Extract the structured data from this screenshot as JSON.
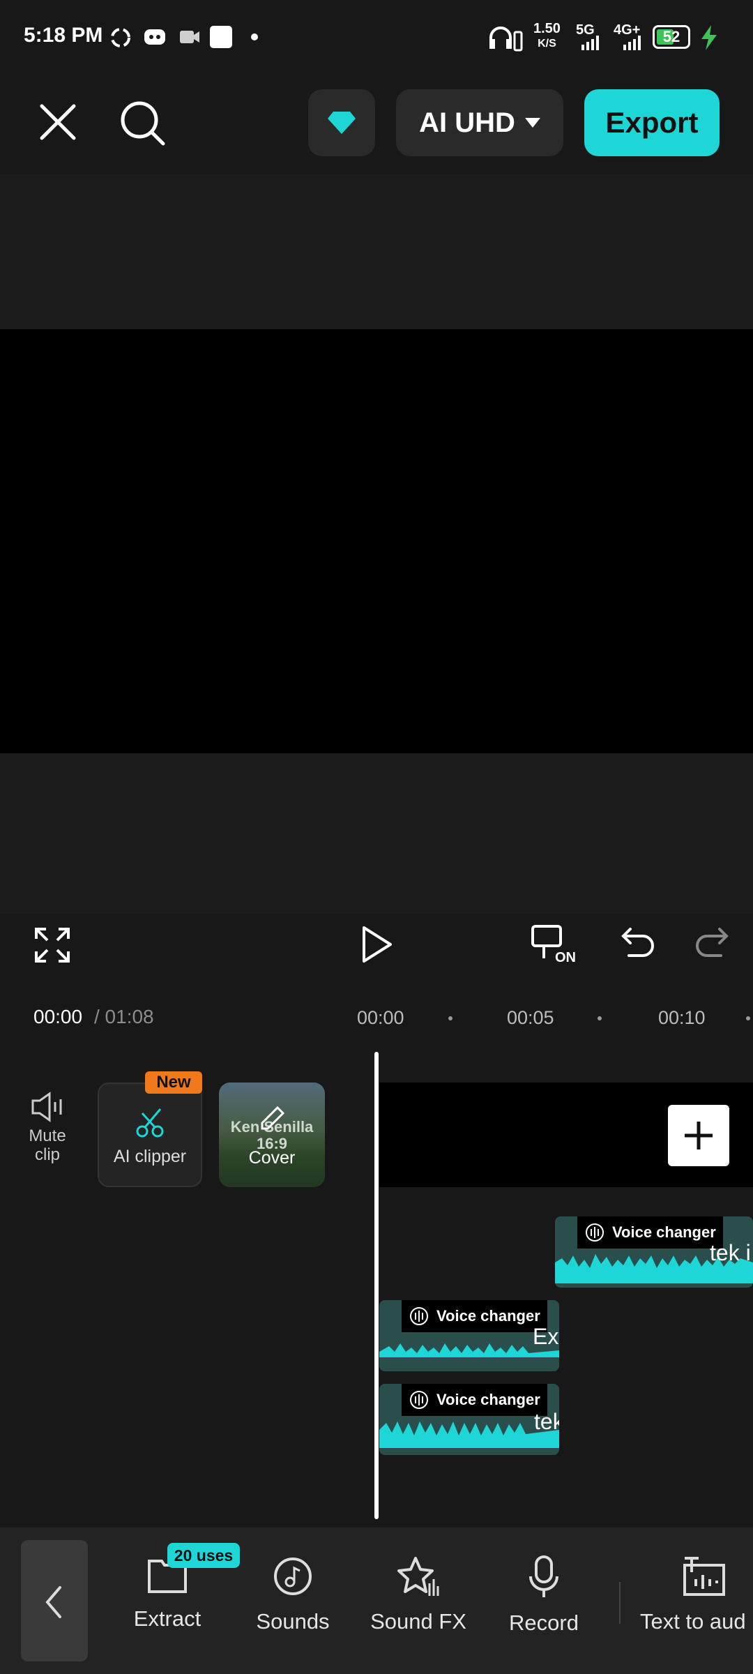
{
  "status_bar": {
    "time": "5:18 PM",
    "net_speed_top": "1.50",
    "net_speed_bottom": "K/S",
    "net1": "5G",
    "net2": "4G+",
    "battery": "52"
  },
  "top_bar": {
    "resolution_label": "AI UHD",
    "export_label": "Export"
  },
  "playback": {
    "current_time": "00:00",
    "total_time": "/ 01:08",
    "ruler_ticks": [
      "00:00",
      "00:05",
      "00:10"
    ]
  },
  "timeline_tools": {
    "mute_label_line1": "Mute",
    "mute_label_line2": "clip",
    "ai_clipper_label": "AI clipper",
    "ai_clipper_badge": "New",
    "cover_label": "Cover",
    "cover_text_line1": "Ken Senilla",
    "cover_text_line2": "16:9"
  },
  "audio_tracks": [
    {
      "label": "Voice changer",
      "trail": "tek i"
    },
    {
      "label": "Voice changer",
      "trail": "Ext"
    },
    {
      "label": "Voice changer",
      "trail": "tek"
    }
  ],
  "toolbar": {
    "items": [
      {
        "label": "Extract",
        "badge": "20 uses",
        "icon": "extract-icon"
      },
      {
        "label": "Sounds",
        "icon": "sounds-icon"
      },
      {
        "label": "Sound FX",
        "icon": "sound-fx-icon"
      },
      {
        "label": "Record",
        "icon": "microphone-icon"
      },
      {
        "label": "Text to aud",
        "icon": "text-to-audio-icon"
      }
    ]
  },
  "colors": {
    "accent": "#1ed6d6",
    "badge_new": "#f07a1a",
    "audio_clip_bg": "#2a4e4b",
    "waveform": "#1ed6d6"
  }
}
